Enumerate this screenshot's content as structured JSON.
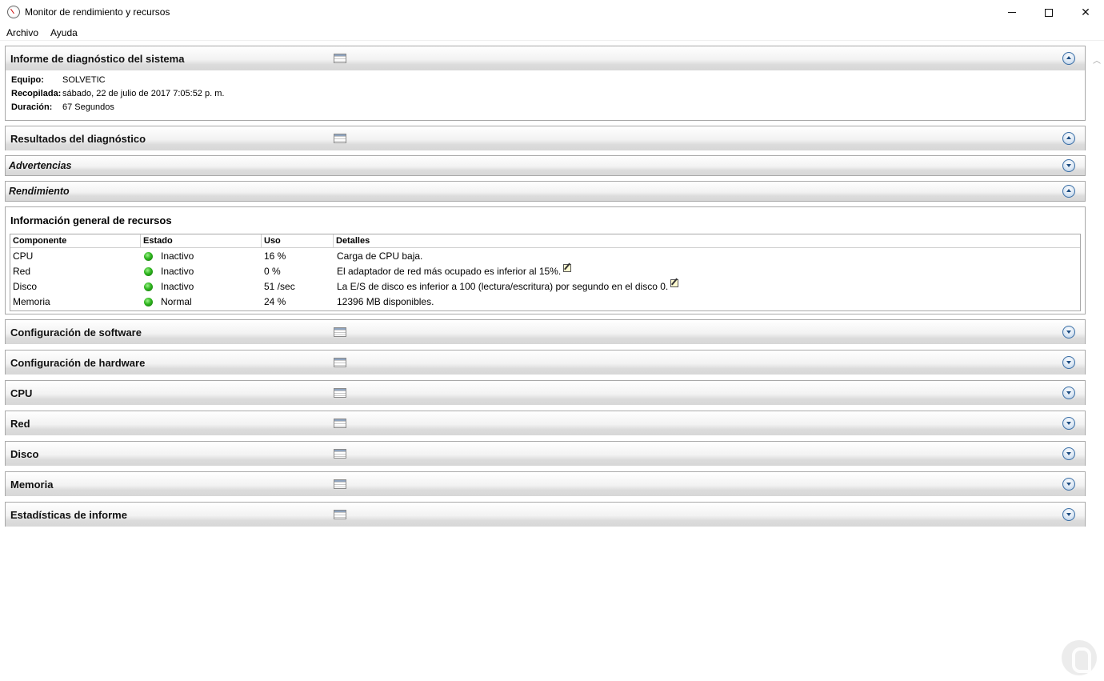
{
  "window": {
    "title": "Monitor de rendimiento y recursos",
    "minimize_icon": "minimize-icon",
    "maximize_icon": "maximize-icon",
    "close_icon": "close-icon"
  },
  "menu": {
    "archivo": "Archivo",
    "ayuda": "Ayuda"
  },
  "report": {
    "title": "Informe de diagnóstico del sistema",
    "info": [
      {
        "label": "Equipo:",
        "value": "SOLVETIC"
      },
      {
        "label": "Recopilada:",
        "value": "sábado, 22 de julio de 2017 7:05:52 p. m."
      },
      {
        "label": "Duración:",
        "value": "67 Segundos"
      }
    ]
  },
  "results": {
    "title": "Resultados del diagnóstico"
  },
  "warnings": {
    "title": "Advertencias"
  },
  "performance": {
    "title": "Rendimiento"
  },
  "resources": {
    "title": "Información general de recursos",
    "columns": [
      "Componente",
      "Estado",
      "Uso",
      "Detalles"
    ],
    "rows": [
      {
        "component": "CPU",
        "status": "Inactivo",
        "usage": "16 %",
        "details": "Carga de CPU baja."
      },
      {
        "component": "Red",
        "status": "Inactivo",
        "usage": "0 %",
        "details": "El adaptador de red más ocupado es inferior al 15%."
      },
      {
        "component": "Disco",
        "status": "Inactivo",
        "usage": "51 /sec",
        "details": "La E/S de disco es inferior a 100 (lectura/escritura) por segundo en el disco 0."
      },
      {
        "component": "Memoria",
        "status": "Normal",
        "usage": "24 %",
        "details": "12396 MB disponibles."
      }
    ]
  },
  "sections": {
    "software": "Configuración de software",
    "hardware": "Configuración de hardware",
    "cpu": "CPU",
    "network": "Red",
    "disk": "Disco",
    "memory": "Memoria",
    "stats": "Estadísticas de informe"
  },
  "colors": {
    "status_ok": "#2fb51f",
    "toggle_accent": "#1d4d82",
    "header_gradient_end": "#d7d7d7"
  }
}
